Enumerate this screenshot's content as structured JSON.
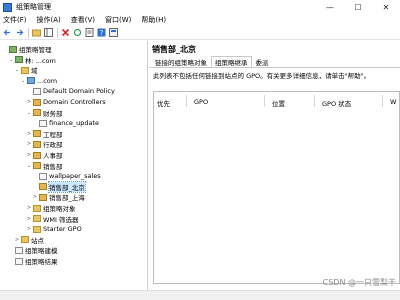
{
  "window": {
    "title": "组策略管理",
    "min": "—",
    "max": "☐",
    "close": "✕"
  },
  "menu": [
    "文件(F)",
    "操作(A)",
    "查看(V)",
    "窗口(W)",
    "帮助(H)"
  ],
  "tree": [
    {
      "label": "组策略管理",
      "level": 0,
      "expander": "",
      "icon": "ic-forest"
    },
    {
      "label": "林: ...com",
      "level": 1,
      "expander": "⌄",
      "icon": "ic-forest"
    },
    {
      "label": "域",
      "level": 2,
      "expander": "⌄",
      "icon": "ic-folder"
    },
    {
      "label": "...com",
      "level": 3,
      "expander": "⌄",
      "icon": "ic-domain"
    },
    {
      "label": "Default Domain Policy",
      "level": 4,
      "expander": "",
      "icon": "ic-gpo"
    },
    {
      "label": "Domain Controllers",
      "level": 4,
      "expander": ">",
      "icon": "ic-ou"
    },
    {
      "label": "财务部",
      "level": 4,
      "expander": "⌄",
      "icon": "ic-ou"
    },
    {
      "label": "finance_update",
      "level": 5,
      "expander": "",
      "icon": "ic-gpo"
    },
    {
      "label": "工程部",
      "level": 4,
      "expander": ">",
      "icon": "ic-ou"
    },
    {
      "label": "行政部",
      "level": 4,
      "expander": ">",
      "icon": "ic-ou"
    },
    {
      "label": "人事部",
      "level": 4,
      "expander": ">",
      "icon": "ic-ou"
    },
    {
      "label": "销售部",
      "level": 4,
      "expander": "⌄",
      "icon": "ic-ou"
    },
    {
      "label": "wallpaper_sales",
      "level": 5,
      "expander": "",
      "icon": "ic-gpo"
    },
    {
      "label": "销售部_北京",
      "level": 5,
      "expander": "",
      "icon": "ic-ou",
      "selected": true
    },
    {
      "label": "销售部_上海",
      "level": 5,
      "expander": ">",
      "icon": "ic-ou"
    },
    {
      "label": "组策略对象",
      "level": 4,
      "expander": ">",
      "icon": "ic-folder"
    },
    {
      "label": "WMI 筛选器",
      "level": 4,
      "expander": ">",
      "icon": "ic-folder"
    },
    {
      "label": "Starter GPO",
      "level": 4,
      "expander": ">",
      "icon": "ic-folder"
    },
    {
      "label": "站点",
      "level": 2,
      "expander": ">",
      "icon": "ic-folder"
    },
    {
      "label": "组策略建模",
      "level": 1,
      "expander": "",
      "icon": "ic-gpo"
    },
    {
      "label": "组策略结果",
      "level": 1,
      "expander": "",
      "icon": "ic-gpo"
    }
  ],
  "details": {
    "title": "销售部_北京",
    "tabs": [
      "链接的组策略对象",
      "组策略继承",
      "委派"
    ],
    "active_tab": 1,
    "info": "此列表不包括任何链接到站点的 GPO。有关更多详细信息，请单击\"帮助\"。",
    "columns": [
      "优先",
      "GPO",
      "位置",
      "GPO 状态",
      "W"
    ]
  },
  "watermark": "CSDN @一只雪梨干"
}
